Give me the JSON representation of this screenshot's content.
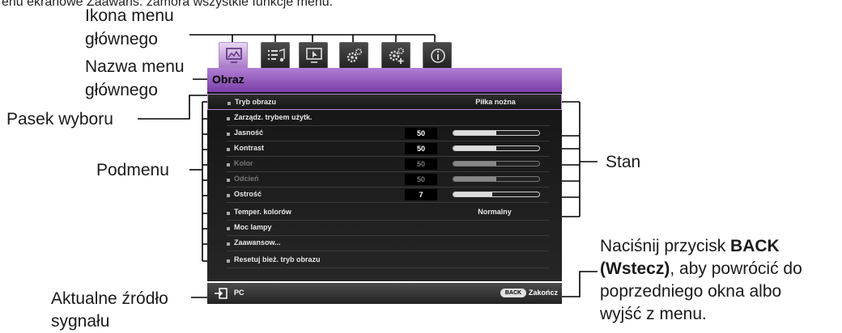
{
  "top_caption": "enu ekranowe Zaawans. zamora wszystkie funkcje menu.",
  "callouts": {
    "main_menu_icon": [
      "Ikona menu",
      "głównego"
    ],
    "main_menu_name": [
      "Nazwa menu",
      "głównego"
    ],
    "selection_bar": "Pasek wyboru",
    "submenu": "Podmenu",
    "current_source": [
      "Aktualne źródło",
      "sygnału"
    ],
    "status": "Stan",
    "back_note": {
      "line1_prefix": "Naciśnij przycisk ",
      "line1_bold": "BACK",
      "line2_bold": "(Wstecz)",
      "line2_rest": ", aby powrócić do",
      "line3": "poprzedniego okna albo",
      "line4": "wyjść z menu."
    }
  },
  "osd": {
    "tabs": [
      {
        "icon": "picture-icon",
        "active": true
      },
      {
        "icon": "audio-settings-icon",
        "active": false
      },
      {
        "icon": "display-icon",
        "active": false
      },
      {
        "icon": "system-setup-basic-icon",
        "active": false
      },
      {
        "icon": "system-setup-advanced-icon",
        "active": false
      },
      {
        "icon": "information-icon",
        "active": false
      }
    ],
    "menu_title": "Obraz",
    "items": [
      {
        "label": "Tryb obrazu",
        "text": "Piłka nożna",
        "selected": true
      },
      {
        "label": "Zarządz. trybem użytk."
      },
      {
        "label": "Jasność",
        "value": "50",
        "level": 0.5
      },
      {
        "label": "Kontrast",
        "value": "50",
        "level": 0.5
      },
      {
        "label": "Kolor",
        "value": "50",
        "level": 0.5,
        "disabled": true
      },
      {
        "label": "Odcień",
        "value": "50",
        "level": 0.5,
        "disabled": true
      },
      {
        "label": "Ostrość",
        "value": "7",
        "level": 0.45
      },
      {
        "label": "Temper. kolorów",
        "text": "Normalny"
      },
      {
        "label": "Moc lampy"
      },
      {
        "label": "Zaawansow..."
      },
      {
        "label": "Resetuj bież. tryb obrazu"
      }
    ],
    "source": "PC",
    "back_key": "BACK",
    "exit_label": "Zakończ",
    "colors": {
      "accent": "#8e55b8",
      "panel": "#1c1c1c"
    }
  }
}
